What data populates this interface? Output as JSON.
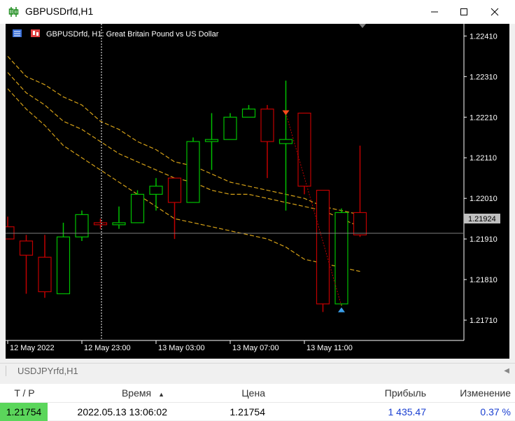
{
  "window": {
    "title": "GBPUSDrfd,H1",
    "minimize_icon": "minimize-icon",
    "maximize_icon": "maximize-icon",
    "close_icon": "close-icon"
  },
  "chart": {
    "header": "GBPUSDrfd, H1:  Great Britain Pound vs US Dollar",
    "y_ticks": [
      "1.22410",
      "1.22310",
      "1.22210",
      "1.22110",
      "1.22010",
      "1.21910",
      "1.21810",
      "1.21710"
    ],
    "current_price_label": "1.21924",
    "x_ticks": [
      "12 May 2022",
      "12 May 23:00",
      "13 May 03:00",
      "13 May 07:00",
      "13 May 11:00"
    ],
    "colors": {
      "background": "#000000",
      "bull": "#00c000",
      "bear": "#c00000",
      "envelope": "#d4a017",
      "grid_line": "#808080"
    }
  },
  "chart_data": {
    "type": "candlestick",
    "ylim": [
      1.2166,
      1.2244
    ],
    "candles": [
      {
        "o": 1.2194,
        "h": 1.21965,
        "l": 1.2191,
        "c": 1.2191
      },
      {
        "o": 1.21905,
        "h": 1.2192,
        "l": 1.21775,
        "c": 1.2187
      },
      {
        "o": 1.21865,
        "h": 1.2192,
        "l": 1.21765,
        "c": 1.2178
      },
      {
        "o": 1.21775,
        "h": 1.2195,
        "l": 1.21775,
        "c": 1.21915
      },
      {
        "o": 1.21915,
        "h": 1.2198,
        "l": 1.21905,
        "c": 1.2197
      },
      {
        "o": 1.2195,
        "h": 1.2196,
        "l": 1.21935,
        "c": 1.21945
      },
      {
        "o": 1.21945,
        "h": 1.2199,
        "l": 1.21935,
        "c": 1.2195
      },
      {
        "o": 1.2195,
        "h": 1.2203,
        "l": 1.2195,
        "c": 1.2202
      },
      {
        "o": 1.2202,
        "h": 1.2206,
        "l": 1.2198,
        "c": 1.2204
      },
      {
        "o": 1.2206,
        "h": 1.2206,
        "l": 1.2191,
        "c": 1.22
      },
      {
        "o": 1.22,
        "h": 1.2216,
        "l": 1.22,
        "c": 1.2215
      },
      {
        "o": 1.2215,
        "h": 1.2222,
        "l": 1.2208,
        "c": 1.22155
      },
      {
        "o": 1.22155,
        "h": 1.2222,
        "l": 1.22155,
        "c": 1.2221
      },
      {
        "o": 1.2221,
        "h": 1.2224,
        "l": 1.2221,
        "c": 1.2223
      },
      {
        "o": 1.2223,
        "h": 1.2224,
        "l": 1.2206,
        "c": 1.2215
      },
      {
        "o": 1.22145,
        "h": 1.223,
        "l": 1.2198,
        "c": 1.22155
      },
      {
        "o": 1.2222,
        "h": 1.2222,
        "l": 1.2202,
        "c": 1.2204
      },
      {
        "o": 1.2203,
        "h": 1.2203,
        "l": 1.2173,
        "c": 1.2175
      },
      {
        "o": 1.2175,
        "h": 1.21985,
        "l": 1.21745,
        "c": 1.21975
      },
      {
        "o": 1.21975,
        "h": 1.2214,
        "l": 1.21915,
        "c": 1.2192
      }
    ],
    "envelope_upper": [
      1.2236,
      1.2231,
      1.2229,
      1.2226,
      1.2224,
      1.222,
      1.2218,
      1.2215,
      1.2213,
      1.221,
      1.2209,
      1.2207,
      1.2205,
      1.2204,
      1.2203,
      1.2202,
      1.2201,
      1.2199,
      1.2198,
      1.2197
    ],
    "envelope_mid": [
      1.2232,
      1.2227,
      1.2224,
      1.222,
      1.2218,
      1.2215,
      1.2212,
      1.221,
      1.2208,
      1.2206,
      1.2205,
      1.2203,
      1.2202,
      1.2202,
      1.2201,
      1.22,
      1.2199,
      1.2198,
      1.2196,
      1.2194
    ],
    "envelope_lower": [
      1.2228,
      1.2223,
      1.2219,
      1.2214,
      1.2211,
      1.2208,
      1.2205,
      1.2202,
      1.2199,
      1.2196,
      1.2195,
      1.2194,
      1.2193,
      1.2192,
      1.2191,
      1.2189,
      1.2186,
      1.2185,
      1.2184,
      1.2183
    ]
  },
  "tab": {
    "label": "USDJPYrfd,H1",
    "scroll_icon": "chevron-left-icon"
  },
  "table": {
    "headers": {
      "tp": "T / P",
      "time": "Время",
      "price": "Цена",
      "profit": "Прибыль",
      "change": "Изменение"
    },
    "sort_icon": "sort-up-icon",
    "row": {
      "tp": "1.21754",
      "time": "2022.05.13 13:06:02",
      "price": "1.21754",
      "profit": "1 435.47",
      "change": "0.37 %"
    },
    "tp_highlight": "#5bd65b"
  }
}
